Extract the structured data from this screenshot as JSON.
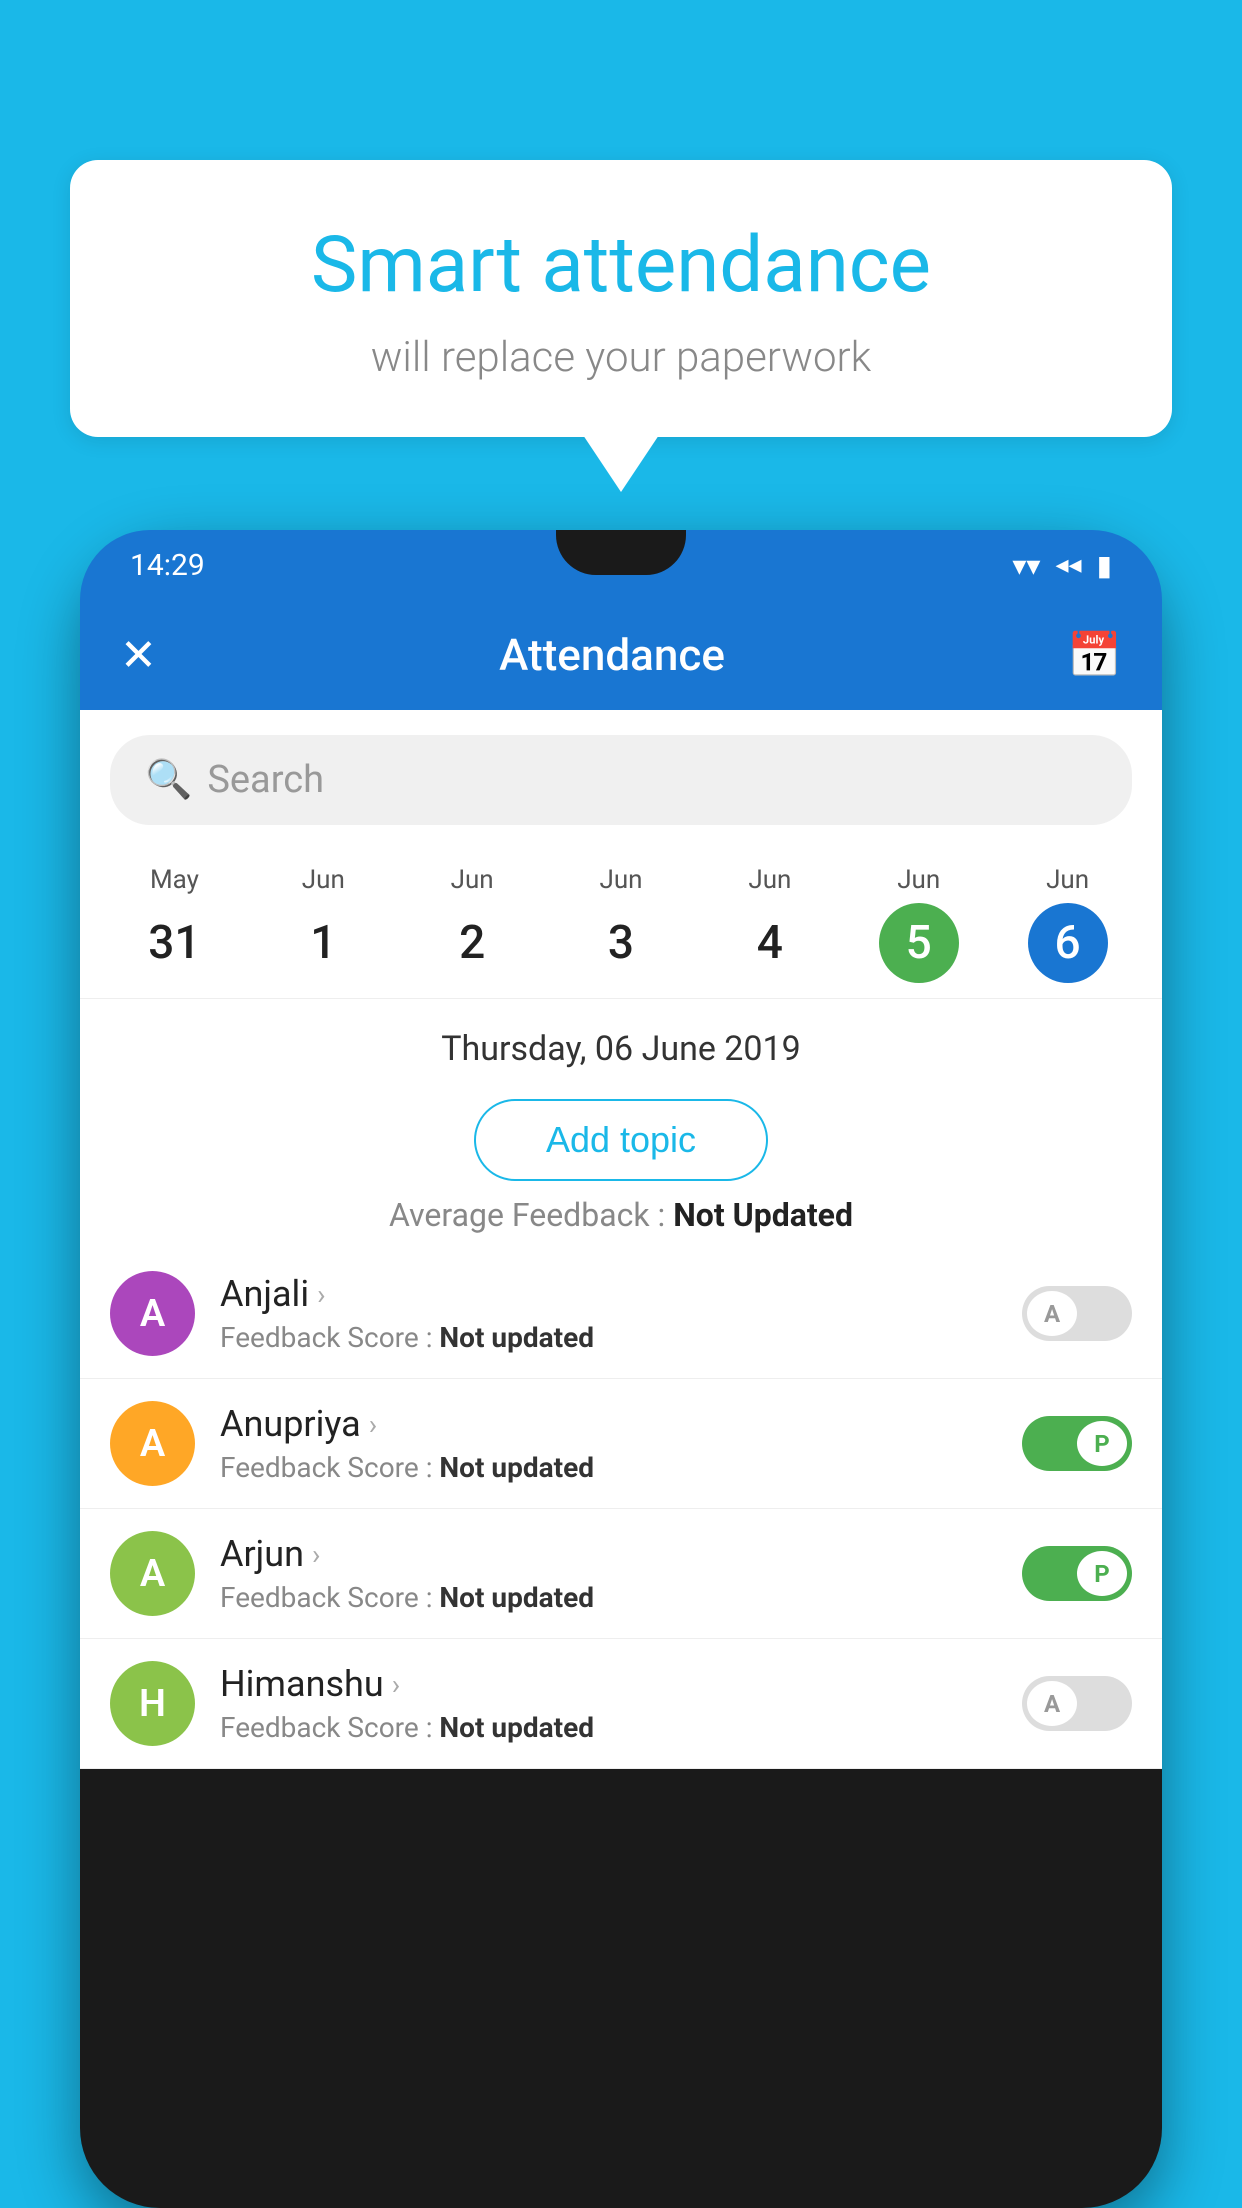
{
  "background": {
    "color": "#1ab8e8"
  },
  "speech_bubble": {
    "title": "Smart attendance",
    "subtitle": "will replace your paperwork"
  },
  "status_bar": {
    "time": "14:29",
    "wifi": "▼",
    "signal": "◀",
    "battery": "▮"
  },
  "app_bar": {
    "title": "Attendance",
    "close_label": "✕",
    "calendar_label": "📅"
  },
  "search": {
    "placeholder": "Search"
  },
  "calendar": {
    "months": [
      "May",
      "Jun",
      "Jun",
      "Jun",
      "Jun",
      "Jun",
      "Jun"
    ],
    "days": [
      "31",
      "1",
      "2",
      "3",
      "4",
      "5",
      "6"
    ],
    "selected_green": 5,
    "selected_blue": 6
  },
  "selected_date": {
    "label": "Thursday, 06 June 2019"
  },
  "add_topic": {
    "label": "Add topic"
  },
  "avg_feedback": {
    "label": "Average Feedback :",
    "value": "Not Updated"
  },
  "students": [
    {
      "name": "Anjali",
      "avatar_letter": "A",
      "avatar_color": "#ab47bc",
      "feedback": "Not updated",
      "toggle": "off",
      "knob_letter": "A"
    },
    {
      "name": "Anupriya",
      "avatar_letter": "A",
      "avatar_color": "#ffa726",
      "feedback": "Not updated",
      "toggle": "on",
      "knob_letter": "P"
    },
    {
      "name": "Arjun",
      "avatar_letter": "A",
      "avatar_color": "#8bc34a",
      "feedback": "Not updated",
      "toggle": "on",
      "knob_letter": "P"
    },
    {
      "name": "Himanshu",
      "avatar_letter": "H",
      "avatar_color": "#8bc34a",
      "feedback": "Not updated",
      "toggle": "off",
      "knob_letter": "A"
    }
  ],
  "feedback_label": "Feedback Score : "
}
